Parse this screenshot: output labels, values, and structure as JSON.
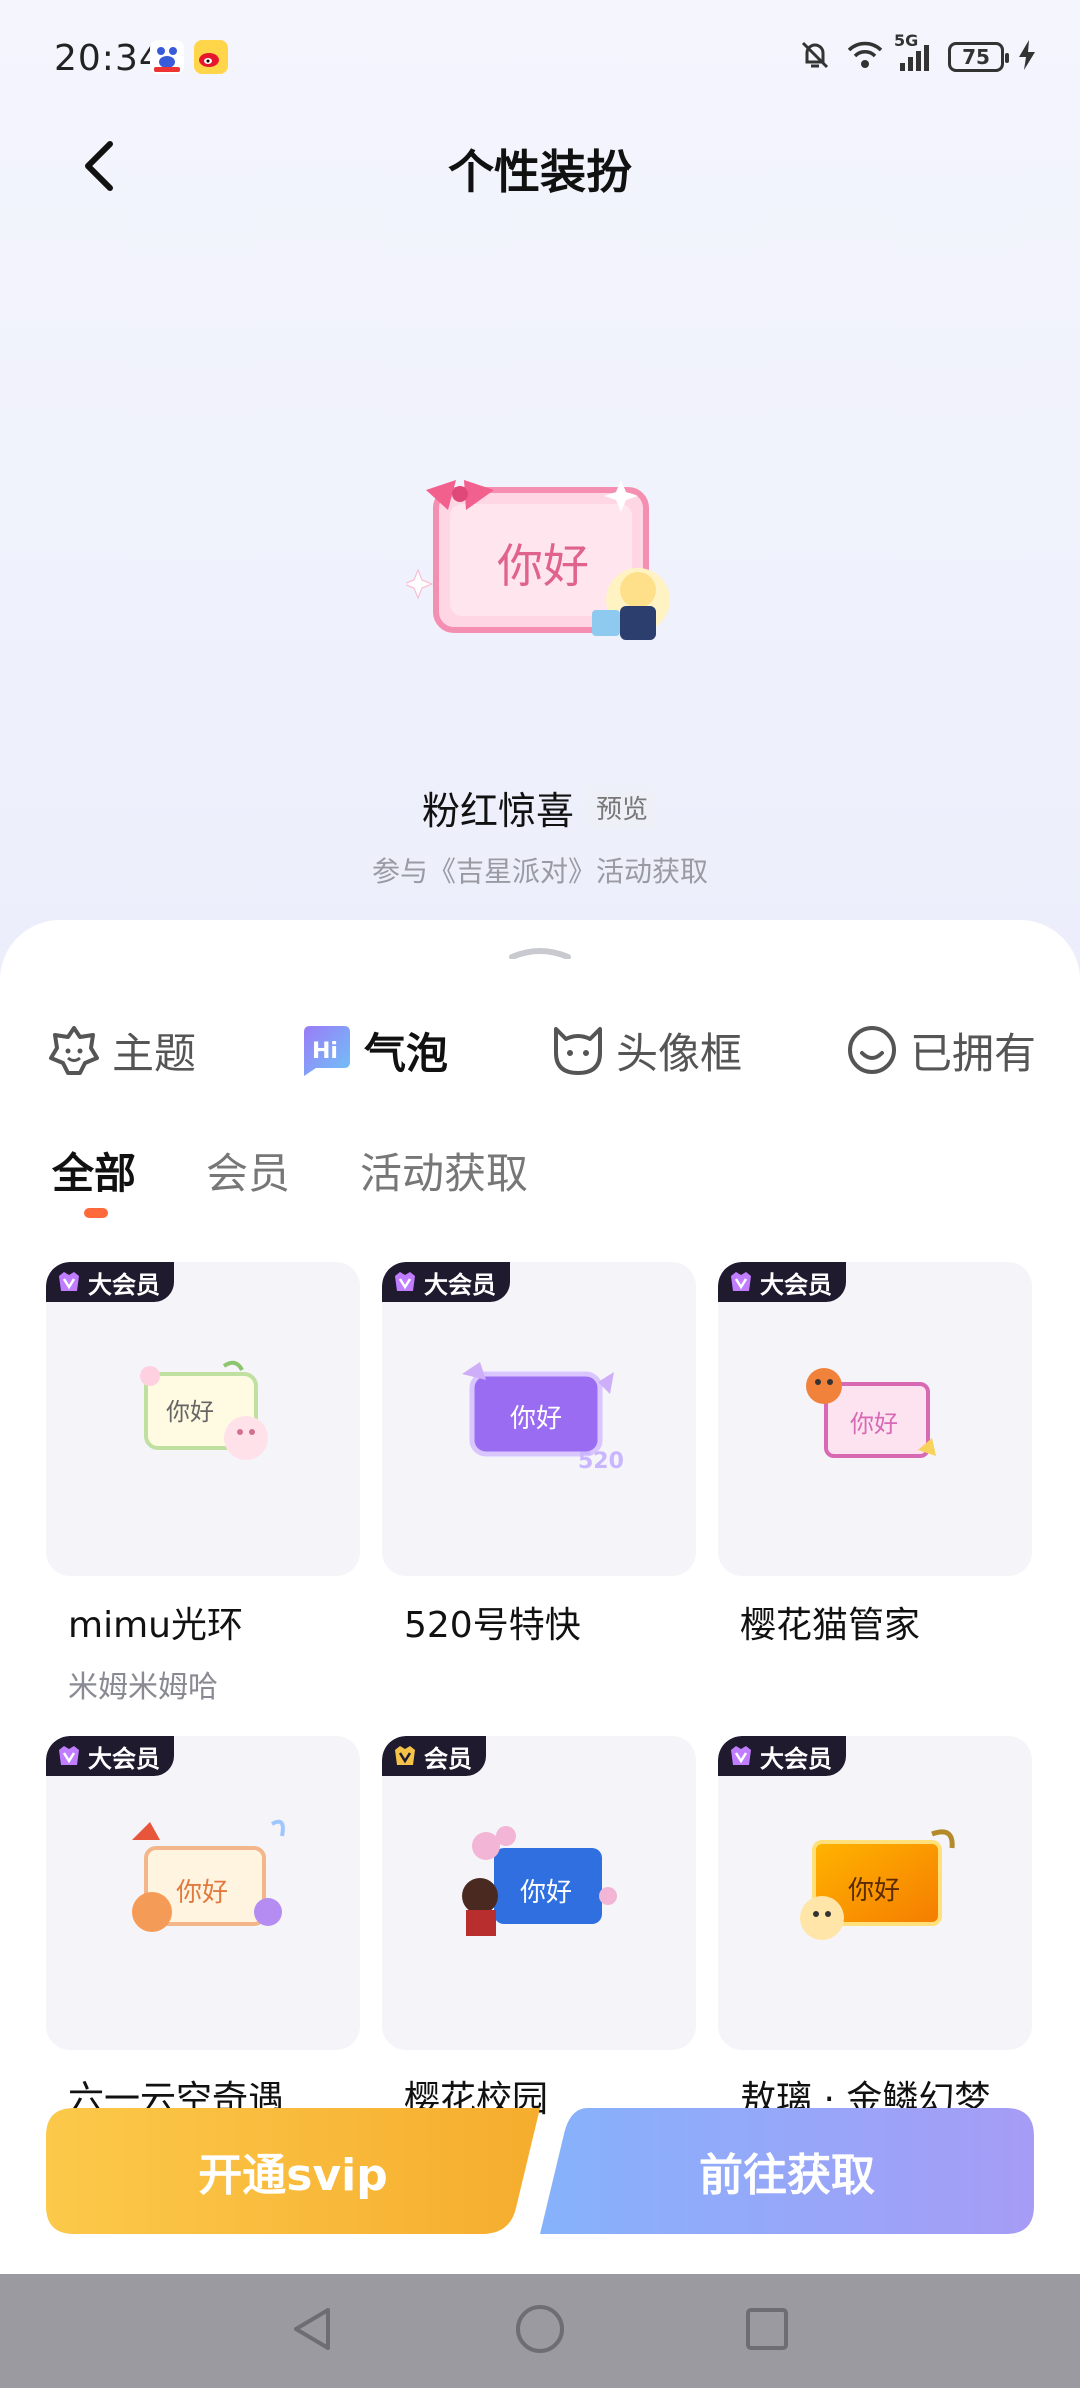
{
  "status_bar": {
    "time": "20:34",
    "network": "5G",
    "battery": "75",
    "icons": [
      "baidu-app-icon",
      "weibo-app-icon",
      "mute-bell-icon",
      "wifi-icon",
      "signal-icon",
      "battery-icon",
      "charging-icon"
    ]
  },
  "header": {
    "title": "个性装扮",
    "back_icon": "back-arrow-icon"
  },
  "preview": {
    "bubble_text": "你好",
    "name": "粉红惊喜",
    "tag": "预览",
    "source": "参与《吉星派对》活动获取"
  },
  "category_tabs": [
    {
      "label": "主题",
      "icon": "theme-icon",
      "active": false
    },
    {
      "label": "气泡",
      "icon": "bubble-hi-icon",
      "active": true
    },
    {
      "label": "头像框",
      "icon": "avatar-frame-icon",
      "active": false
    },
    {
      "label": "已拥有",
      "icon": "owned-smile-icon",
      "active": false
    }
  ],
  "filter_tabs": [
    {
      "label": "全部",
      "active": true
    },
    {
      "label": "会员",
      "active": false
    },
    {
      "label": "活动获取",
      "active": false
    }
  ],
  "items": [
    {
      "badge": "大会员",
      "bubble_text": "你好",
      "name": "mimu光环",
      "sub": "米姆米姆哈"
    },
    {
      "badge": "大会员",
      "bubble_text": "你好",
      "name": "520号特快",
      "sub": ""
    },
    {
      "badge": "大会员",
      "bubble_text": "你好",
      "name": "樱花猫管家",
      "sub": ""
    },
    {
      "badge": "大会员",
      "bubble_text": "你好",
      "name": "六一云空奇遇",
      "sub": ""
    },
    {
      "badge": "会员",
      "bubble_text": "你好",
      "name": "樱花校园",
      "sub": ""
    },
    {
      "badge": "大会员",
      "bubble_text": "你好",
      "name": "敖璃 · 金鳞幻梦",
      "sub": ""
    }
  ],
  "actions": {
    "svip_label": "开通svip",
    "get_label": "前往获取"
  },
  "colors": {
    "svip_button": "#f7b733",
    "get_button": "#8ba8f8",
    "accent": "#ff6a3d",
    "badge_bg": "#1f1a2e"
  },
  "nav": {
    "icons": [
      "nav-back-icon",
      "nav-home-icon",
      "nav-recents-icon"
    ]
  }
}
